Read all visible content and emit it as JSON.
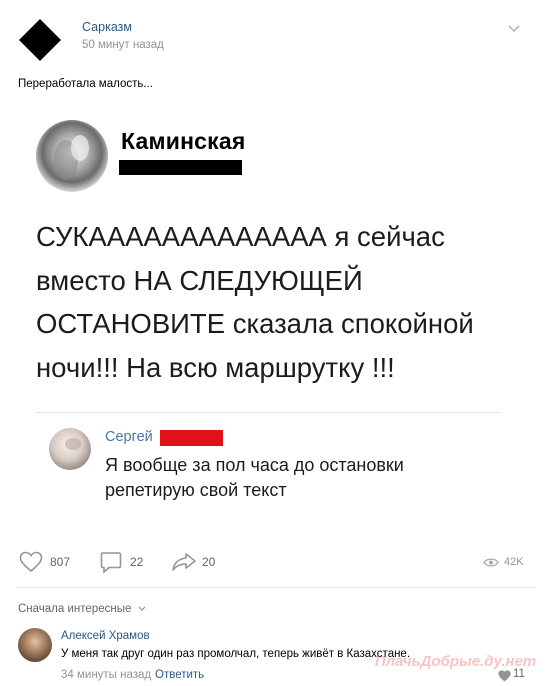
{
  "post": {
    "author": "Сарказм",
    "time": "50 минут назад",
    "text": "Переработала малость..."
  },
  "card": {
    "author_name": "Каминская",
    "tweet_lines": [
      "СУКААААААААААААА я сейчас",
      "вместо НА СЛЕДУЮЩЕЙ",
      "ОСТАНОВИТЕ сказала спокойной",
      "ночи!!! На всю маршрутку !!!"
    ],
    "reply_name": "Сергей",
    "reply_lines": [
      "Я вообще за пол часа до остановки",
      "репетирую свой текст"
    ]
  },
  "actions": {
    "likes": "807",
    "comments": "22",
    "shares": "20",
    "views": "42K"
  },
  "comments": {
    "sort_label": "Сначала интересные",
    "items": [
      {
        "author": "Алексей Храмов",
        "text": "У меня так друг один раз промолчал, теперь живёт в Казахстане.",
        "time": "34 минуты назад",
        "reply_label": "Ответить",
        "likes": "11"
      }
    ]
  },
  "watermark": "ПлачьДобрые.ду.нет",
  "colors": {
    "link": "#2a5885",
    "muted": "#939393",
    "reply_name": "#4a76a8",
    "censor_black": "#000000",
    "censor_red": "#e3101a"
  },
  "icons": {
    "group_avatar": "black-diamond",
    "menu": "chevron-down-icon",
    "like": "heart-icon",
    "comment": "comment-bubble-icon",
    "share": "share-arrow-icon",
    "views": "eye-icon"
  }
}
